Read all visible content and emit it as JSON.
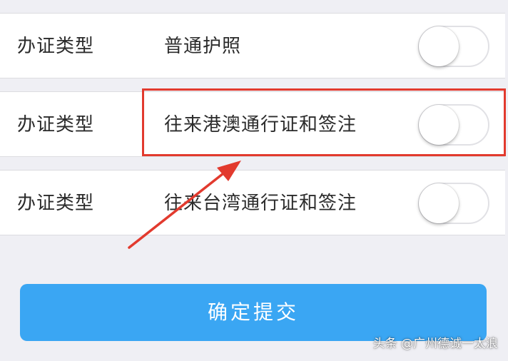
{
  "rows": [
    {
      "label": "办证类型",
      "value": "普通护照",
      "toggle_on": false
    },
    {
      "label": "办证类型",
      "value": "往来港澳通行证和签注",
      "toggle_on": false
    },
    {
      "label": "办证类型",
      "value": "往来台湾通行证和签注",
      "toggle_on": false
    }
  ],
  "submit_label": "确定提交",
  "watermark": "头条 @广州德诚一太浪",
  "colors": {
    "background": "#efeff4",
    "submit_button": "#3aa6f3",
    "highlight": "#e23a2e"
  }
}
